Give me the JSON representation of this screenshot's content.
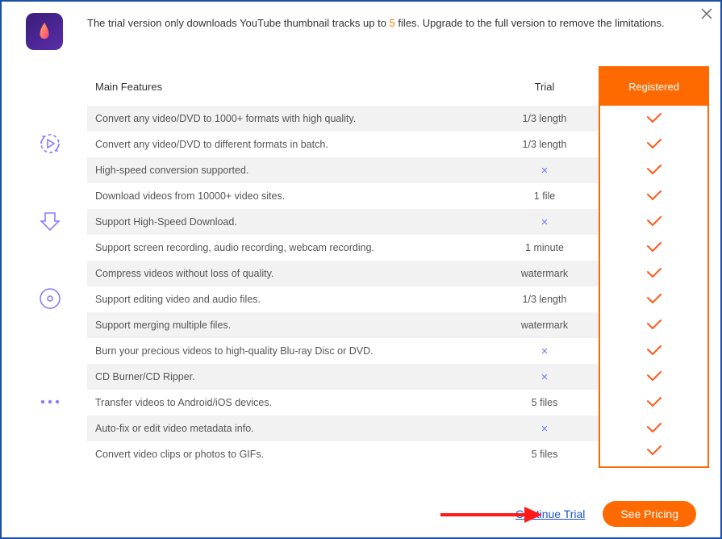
{
  "header": {
    "text_before": "The trial version only downloads YouTube thumbnail tracks up to ",
    "highlight": "5",
    "text_after": " files. Upgrade to the full version to remove the limitations."
  },
  "columns": {
    "features": "Main Features",
    "trial": "Trial",
    "registered": "Registered"
  },
  "groups": [
    {
      "icon": "convert",
      "rows": [
        {
          "feature": "Convert any video/DVD to 1000+ formats with high quality.",
          "trial": "1/3 length",
          "trial_type": "text"
        },
        {
          "feature": "Convert any video/DVD to different formats in batch.",
          "trial": "1/3 length",
          "trial_type": "text"
        },
        {
          "feature": "High-speed conversion supported.",
          "trial": "×",
          "trial_type": "cross"
        }
      ]
    },
    {
      "icon": "download",
      "rows": [
        {
          "feature": "Download videos from 10000+ video sites.",
          "trial": "1 file",
          "trial_type": "text"
        },
        {
          "feature": "Support High-Speed Download.",
          "trial": "×",
          "trial_type": "cross"
        },
        {
          "feature": "Support screen recording, audio recording, webcam recording.",
          "trial": "1 minute",
          "trial_type": "text"
        }
      ]
    },
    {
      "icon": "disc",
      "rows": [
        {
          "feature": "Compress videos without loss of quality.",
          "trial": "watermark",
          "trial_type": "text"
        },
        {
          "feature": "Support editing video and audio files.",
          "trial": "1/3 length",
          "trial_type": "text"
        },
        {
          "feature": "Support merging multiple files.",
          "trial": "watermark",
          "trial_type": "text"
        }
      ]
    },
    {
      "icon": "more",
      "rows": [
        {
          "feature": "Burn your precious videos to high-quality Blu-ray Disc or DVD.",
          "trial": "×",
          "trial_type": "cross"
        },
        {
          "feature": "CD Burner/CD Ripper.",
          "trial": "×",
          "trial_type": "cross"
        },
        {
          "feature": "Transfer videos to Android/iOS devices.",
          "trial": "5 files",
          "trial_type": "text"
        },
        {
          "feature": "Auto-fix or edit video metadata info.",
          "trial": "×",
          "trial_type": "cross"
        },
        {
          "feature": "Convert video clips or photos to GIFs.",
          "trial": "5 files",
          "trial_type": "text"
        }
      ]
    }
  ],
  "buttons": {
    "continue": "Continue Trial",
    "see_pricing": "See Pricing"
  }
}
